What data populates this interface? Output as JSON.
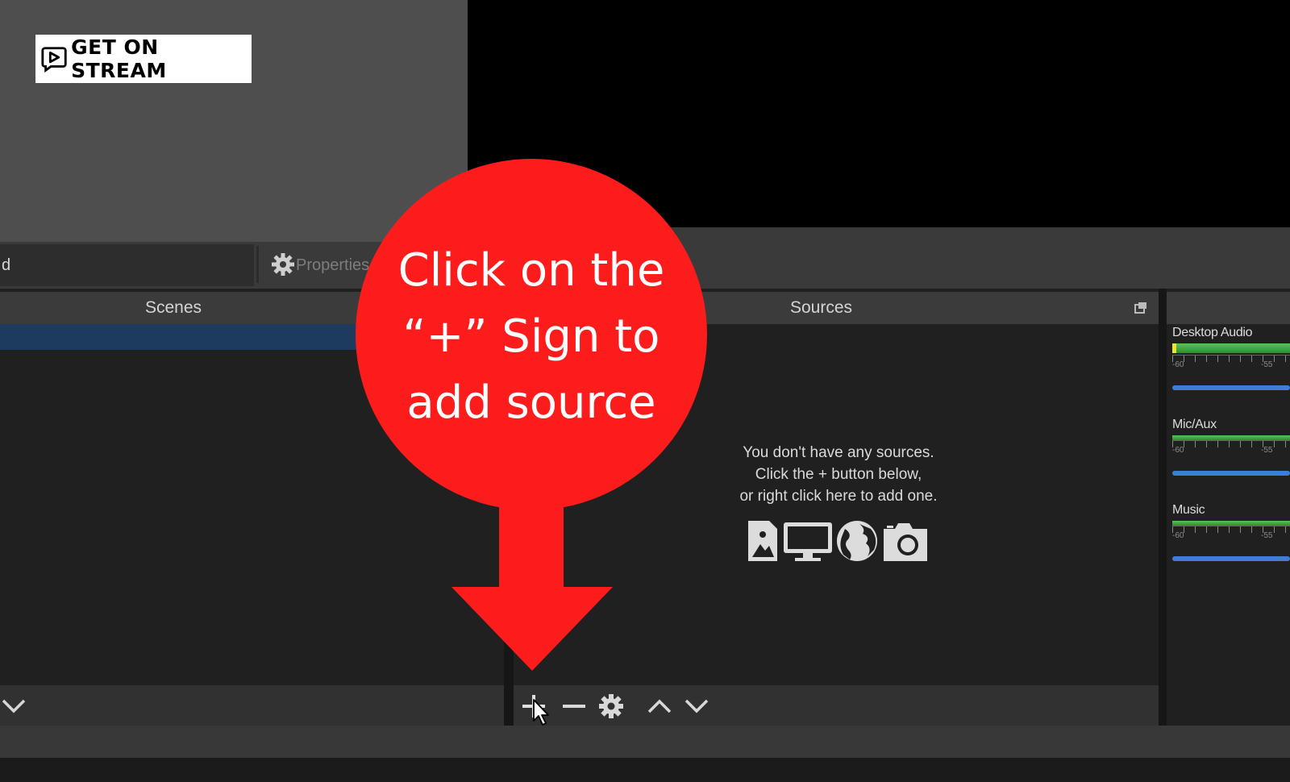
{
  "logo": {
    "text": "GET ON STREAM"
  },
  "context_bar": {
    "scene_name_fragment": "d",
    "properties_label": "Properties"
  },
  "scenes": {
    "title": "Scenes"
  },
  "sources": {
    "title": "Sources",
    "empty_lines": [
      "You don't have any sources.",
      "Click the + button below,",
      "or right click here to add one."
    ],
    "source_type_icons": [
      "image-icon",
      "display-icon",
      "globe-icon",
      "camera-icon"
    ]
  },
  "toolbar_icons": [
    "plus-icon",
    "minus-icon",
    "gear-icon",
    "chevron-up-icon",
    "chevron-down-icon"
  ],
  "mixer": {
    "channels": [
      {
        "name": "Desktop Audio",
        "scale": [
          "-60",
          "-55"
        ]
      },
      {
        "name": "Mic/Aux",
        "scale": [
          "-60",
          "-55"
        ]
      },
      {
        "name": "Music",
        "scale": [
          "-60",
          "-55"
        ]
      }
    ]
  },
  "callout": {
    "lines": [
      "Click on the",
      "“+” Sign to",
      "add source"
    ],
    "color": "#fd1c1c"
  },
  "colors": {
    "panel_bg": "#202020",
    "header_bg": "#3b3b3b",
    "selection": "#1d3a5f",
    "meter_green": "#58c45a",
    "slider_blue": "#3d7fd6"
  }
}
